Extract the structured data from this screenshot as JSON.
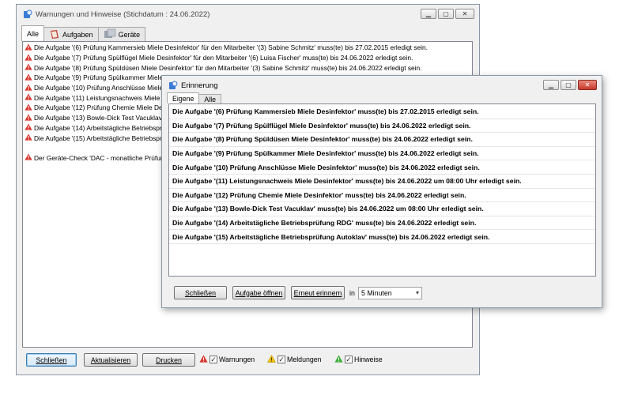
{
  "main_window": {
    "title": "Warnungen und Hinweise (Stichdatum : 24.06.2022)",
    "tabs": [
      {
        "label": "Alle"
      },
      {
        "label": "Aufgaben"
      },
      {
        "label": "Geräte"
      }
    ],
    "rows": [
      "Die Aufgabe '(6) Prüfung Kammersieb Miele Desinfektor' für den Mitarbeiter '(3) Sabine Schmitz' muss(te) bis 27.02.2015 erledigt sein.",
      "Die Aufgabe '(7) Prüfung Spülflügel Miele Desinfektor' für den Mitarbeiter '(6) Luisa Fischer' muss(te) bis 24.06.2022 erledigt sein.",
      "Die Aufgabe '(8) Prüfung Spüldüsen Miele Desinfektor' für den Mitarbeiter '(3) Sabine Schmitz' muss(te) bis 24.06.2022 erledigt sein.",
      "Die Aufgabe '(9) Prüfung Spülkammer Miele Desinfektor' für den Mitarbeiter '(6) Luisa Fischer' muss(te) bis 24.06.2022 erledigt sein.",
      "Die Aufgabe '(10) Prüfung Anschlüsse Miele Desi",
      "Die Aufgabe '(11) Leistungsnachweis Miele Desin",
      "Die Aufgabe '(12) Prüfung Chemie Miele Desinfe",
      "Die Aufgabe '(13) Bowle-Dick Test Vacuklav' für",
      "Die Aufgabe '(14) Arbeitstägliche Betriebsprüfu",
      "Die Aufgabe '(15) Arbeitstägliche Betriebsprüfu",
      "",
      "Der Geräte-Check 'DAC - monatliche Prüfung' fü"
    ],
    "buttons": {
      "close": "Schließen",
      "refresh": "Aktualisieren",
      "print": "Drucken"
    },
    "legend": {
      "warnings": "Warnungen",
      "messages": "Meldungen",
      "hints": "Hinweise"
    }
  },
  "reminder_window": {
    "title": "Erinnerung",
    "tabs": [
      {
        "label": "Eigene"
      },
      {
        "label": "Alle"
      }
    ],
    "rows": [
      "Die Aufgabe '(6) Prüfung Kammersieb Miele Desinfektor' muss(te) bis 27.02.2015 erledigt sein.",
      "Die Aufgabe '(7) Prüfung Spülflügel Miele Desinfektor' muss(te) bis 24.06.2022 erledigt sein.",
      "Die Aufgabe '(8) Prüfung Spüldüsen Miele Desinfektor' muss(te) bis 24.06.2022 erledigt sein.",
      "Die Aufgabe '(9) Prüfung Spülkammer Miele Desinfektor' muss(te) bis 24.06.2022 erledigt sein.",
      "Die Aufgabe '(10) Prüfung Anschlüsse Miele Desinfektor' muss(te) bis 24.06.2022 erledigt sein.",
      "Die Aufgabe '(11) Leistungsnachweis Miele Desinfektor' muss(te) bis 24.06.2022 um 08:00 Uhr erledigt sein.",
      "Die Aufgabe '(12) Prüfung Chemie Miele Desinfektor' muss(te) bis 24.06.2022 erledigt sein.",
      "Die Aufgabe '(13) Bowle-Dick Test Vacuklav' muss(te) bis 24.06.2022 um 08:00 Uhr erledigt sein.",
      "Die Aufgabe '(14) Arbeitstägliche Betriebsprüfung RDG' muss(te) bis 24.06.2022 erledigt sein.",
      "Die Aufgabe '(15) Arbeitstägliche Betriebsprüfung Autoklav' muss(te) bis 24.06.2022 erledigt sein."
    ],
    "buttons": {
      "close": "Schließen",
      "open_task": "Aufgabe öffnen",
      "remind_again": "Erneut erinnern"
    },
    "in_label": "in",
    "interval": "5 Minuten"
  },
  "colors": {
    "warning_red": "#d9342b",
    "message_yellow": "#f2c200",
    "hint_green": "#3fae3b"
  },
  "icons": [
    "app-icon",
    "warning-icon",
    "tasks-icon",
    "devices-icon",
    "minimize-icon",
    "maximize-icon",
    "close-icon",
    "dropdown-arrow-icon"
  ]
}
